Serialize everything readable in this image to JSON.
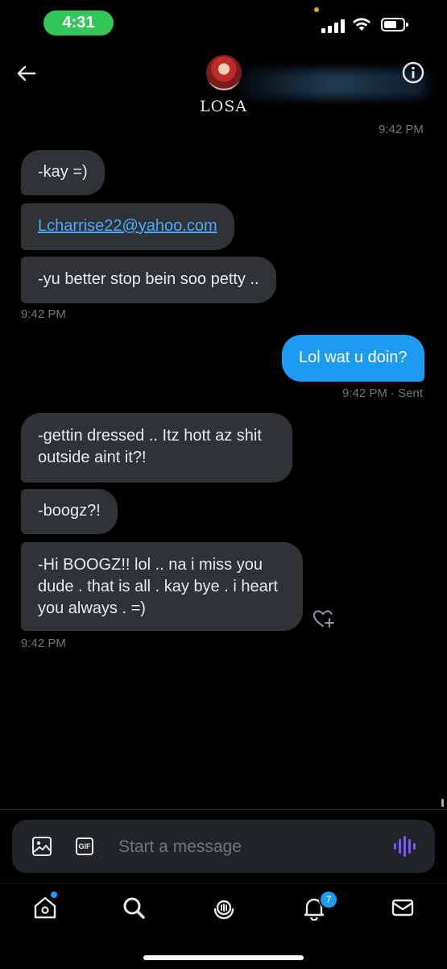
{
  "status_bar": {
    "time": "4:31"
  },
  "header": {
    "display_name": "LOSA"
  },
  "messages": {
    "top_timestamp": "9:42 PM",
    "group1": [
      {
        "text": "-kay =)"
      },
      {
        "text": "Lcharrise22@yahoo.com"
      },
      {
        "text": "-yu better stop bein soo petty .."
      }
    ],
    "group1_timestamp": "9:42 PM",
    "sent": {
      "text": "Lol wat u doin?",
      "timestamp": "9:42 PM",
      "status": "· Sent"
    },
    "group2": [
      {
        "line1": "-gettin dressed .. Itz hott az shit",
        "line2": "outside aint it?!"
      },
      {
        "text": "-boogz?!"
      },
      {
        "line1": "-Hi BOOGZ!! lol .. na i miss you",
        "line2": "dude . that is all . kay bye . i heart",
        "line3": "you always . =)"
      }
    ],
    "group2_timestamp": "9:42 PM"
  },
  "composer": {
    "placeholder": "Start a message",
    "gif_label": "GIF"
  },
  "nav": {
    "notifications_count": "7"
  },
  "colors": {
    "accent": "#1d9bf0",
    "bubble_in": "#2f3336",
    "voice": "#7856ff",
    "time_pill": "#33c759"
  }
}
